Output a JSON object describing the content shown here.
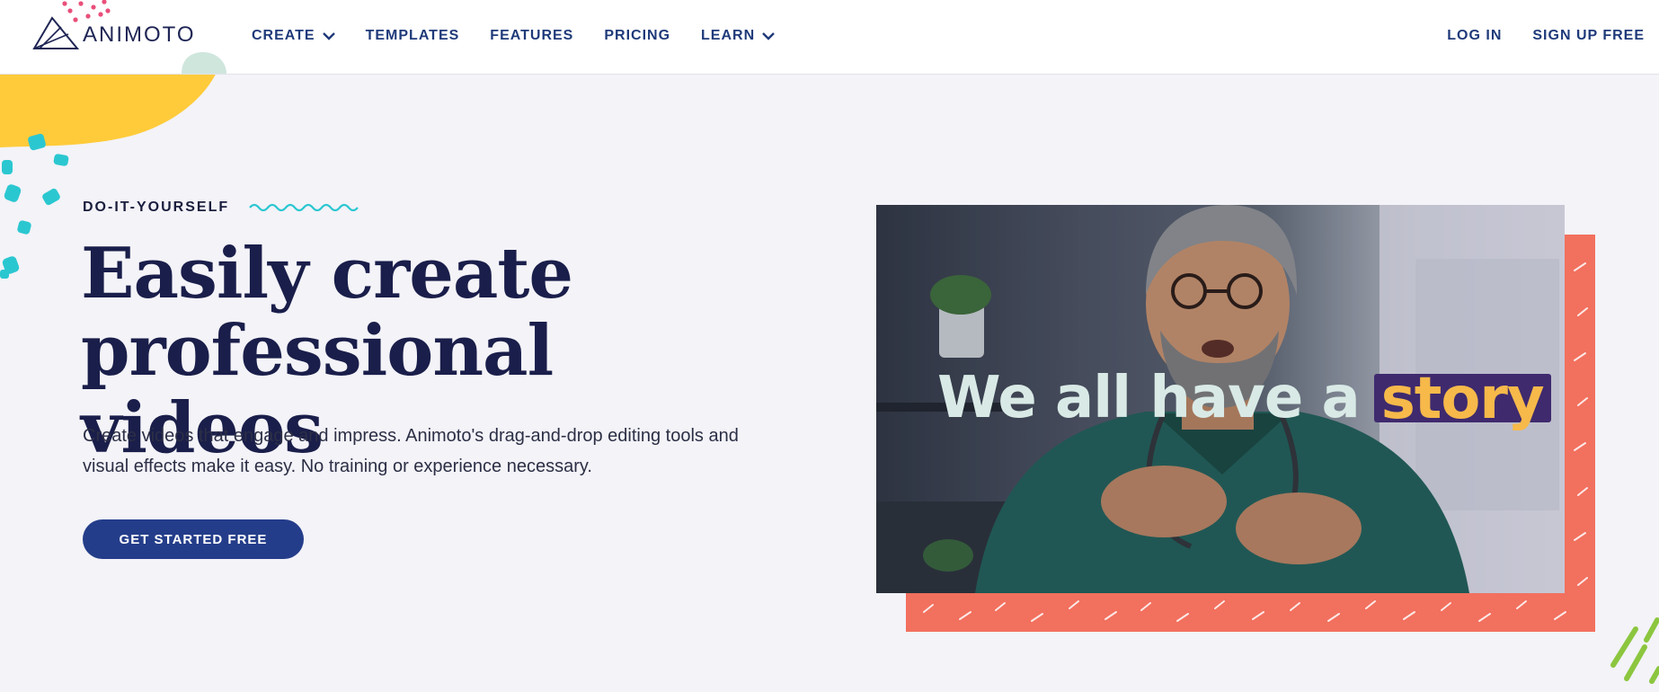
{
  "brand": {
    "logo_text": "ANIMOTO"
  },
  "nav": {
    "items": [
      {
        "label": "CREATE",
        "has_dropdown": true
      },
      {
        "label": "TEMPLATES",
        "has_dropdown": false
      },
      {
        "label": "FEATURES",
        "has_dropdown": false
      },
      {
        "label": "PRICING",
        "has_dropdown": false
      },
      {
        "label": "LEARN",
        "has_dropdown": true
      }
    ],
    "right": {
      "login": "LOG IN",
      "signup": "SIGN UP FREE"
    }
  },
  "hero": {
    "eyebrow": "DO-IT-YOURSELF",
    "headline_line1": "Easily create",
    "headline_line2": "professional videos",
    "subtext_line1": "Create videos that engage and impress. Animoto's drag-and-drop editing tools and",
    "subtext_line2": "visual effects make it easy. No training or experience necessary.",
    "cta": "GET STARTED FREE"
  },
  "video": {
    "caption_prefix": "We all have a",
    "caption_highlight": "story"
  },
  "colors": {
    "nav_text": "#1f3a7a",
    "headline": "#1a1e4a",
    "cta_bg": "#243d8a",
    "accent_coral": "#f2705e",
    "accent_yellow": "#ffcb3a",
    "accent_teal": "#2bc7d0",
    "caption_highlight_bg": "#3f2a6e",
    "caption_highlight_text": "#f6b94a"
  },
  "icons": [
    "animoto-logo-icon",
    "chevron-down-icon",
    "wave-icon",
    "play-video-thumbnail"
  ]
}
